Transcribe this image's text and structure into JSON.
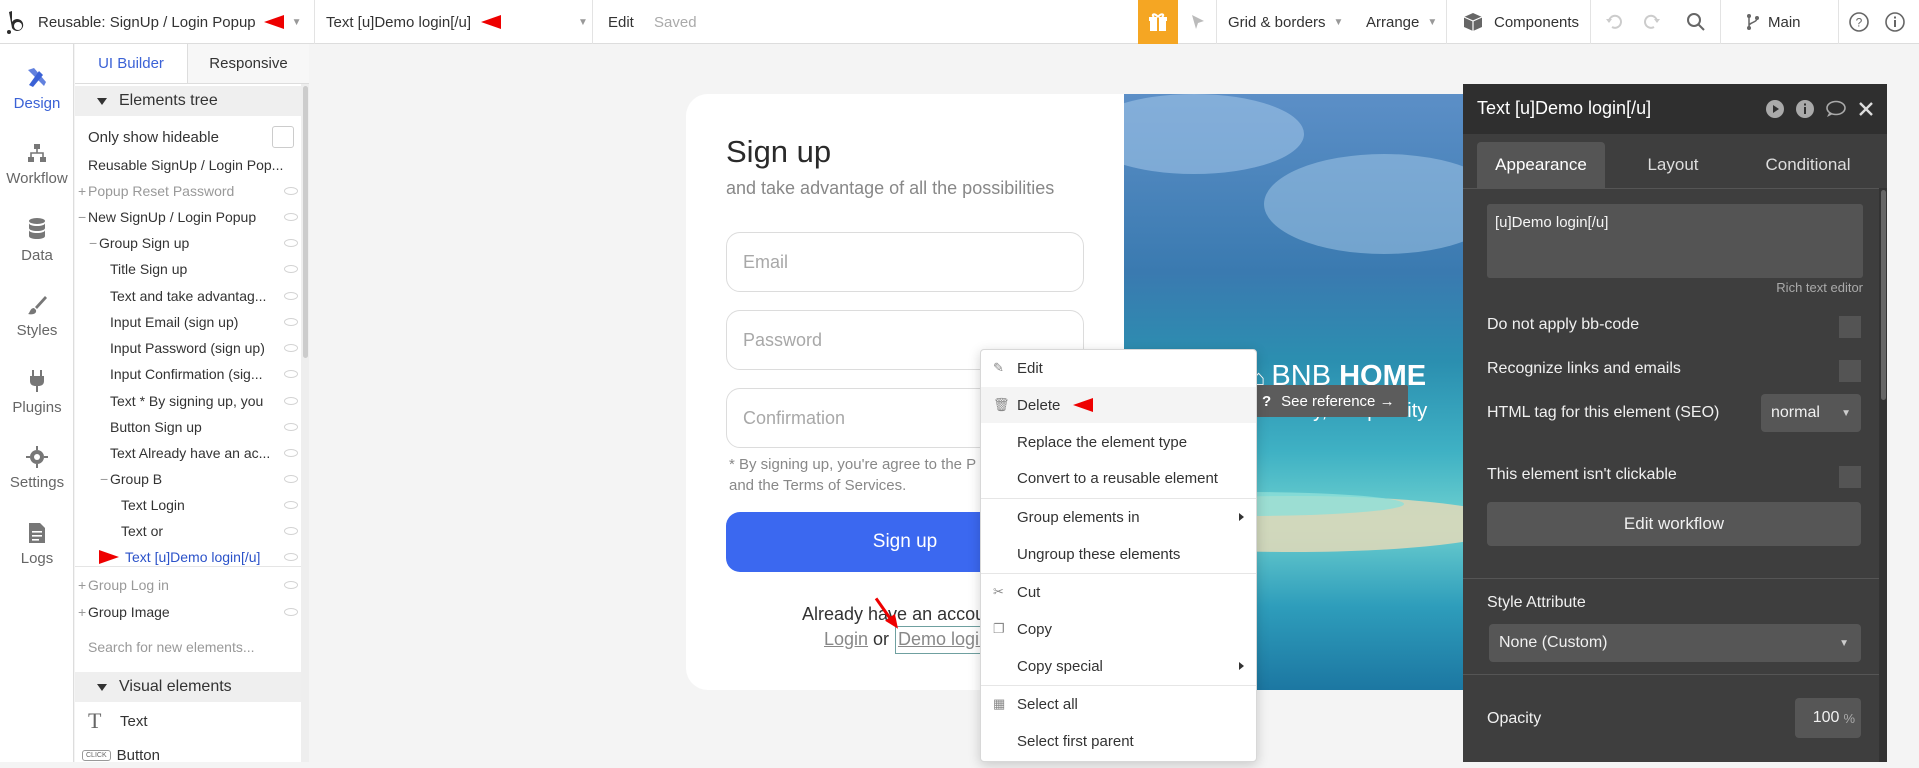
{
  "topbar": {
    "page_label": "Reusable: SignUp / Login Popup",
    "element_label": "Text [u]Demo login[/u]",
    "edit_label": "Edit",
    "saved_label": "Saved",
    "grid_label": "Grid & borders",
    "arrange_label": "Arrange",
    "components_label": "Components",
    "branch_label": "Main"
  },
  "rail": {
    "items": [
      {
        "label": "Design"
      },
      {
        "label": "Workflow"
      },
      {
        "label": "Data"
      },
      {
        "label": "Styles"
      },
      {
        "label": "Plugins"
      },
      {
        "label": "Settings"
      },
      {
        "label": "Logs"
      }
    ]
  },
  "panel": {
    "tabs": [
      "UI Builder",
      "Responsive"
    ],
    "elements_tree_title": "Elements tree",
    "only_hideable": "Only show hideable",
    "tree": [
      "Reusable SignUp / Login Pop...",
      "Popup Reset Password",
      "New SignUp / Login Popup",
      "Group Sign up",
      "Title Sign up",
      "Text and take advantag...",
      "Input Email (sign up)",
      "Input Password (sign up)",
      "Input Confirmation (sig...",
      "Text * By signing up, you",
      "Button Sign up",
      "Text Already have an ac...",
      "Group B",
      "Text Login",
      "Text or",
      "Text [u]Demo login[/u]",
      "Group Log in",
      "Group Image"
    ],
    "search_placeholder": "Search for new elements...",
    "visual_elements_title": "Visual elements",
    "visual_items": [
      "Text",
      "Button"
    ],
    "button_icon_text": "CLICK"
  },
  "canvas": {
    "title": "Sign up",
    "subtitle": "and take advantage of all the possibilities",
    "email_placeholder": "Email",
    "password_placeholder": "Password",
    "confirmation_placeholder": "Confirmation",
    "terms_line1": "* By signing up, you're agree to the P",
    "terms_line2": "and the Terms of Services.",
    "signup_button": "Sign up",
    "already_text": "Already have an accou",
    "login_link": "Login",
    "or_text": "or",
    "demo_link": "Demo login",
    "hero_brand_a": "BNB",
    "hero_brand_b": "HOME",
    "hero_tagline": "our stay, our priority",
    "see_reference": "See reference →"
  },
  "context_menu": {
    "items": [
      "Edit",
      "Delete",
      "Replace the element type",
      "Convert to a reusable element",
      "Group elements in",
      "Ungroup these elements",
      "Cut",
      "Copy",
      "Copy special",
      "Select all",
      "Select first parent"
    ]
  },
  "props": {
    "title": "Text [u]Demo login[/u]",
    "tabs": [
      "Appearance",
      "Layout",
      "Conditional"
    ],
    "content_value": "[u]Demo login[/u]",
    "rich_text_label": "Rich text editor",
    "no_bbcode": "Do not apply bb-code",
    "recognize_links": "Recognize links and emails",
    "html_tag_label": "HTML tag for this element (SEO)",
    "html_tag_value": "normal",
    "not_clickable": "This element isn't clickable",
    "edit_workflow": "Edit workflow",
    "style_attr_label": "Style Attribute",
    "style_attr_value": "None (Custom)",
    "opacity_label": "Opacity",
    "opacity_value": "100",
    "opacity_unit": "%"
  },
  "colors": {
    "accent": "#3b62d6",
    "signup_button": "#3b68f0",
    "annotation_red": "#e00000",
    "gift_orange": "#f5a623"
  }
}
